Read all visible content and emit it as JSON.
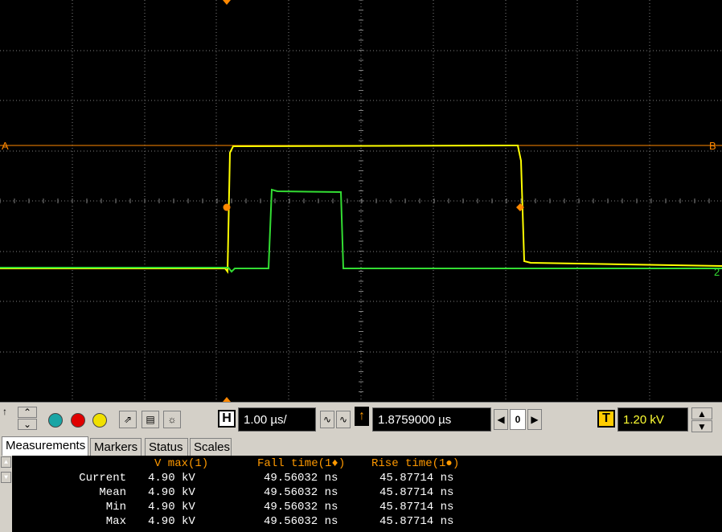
{
  "scope": {
    "marker_left": "A",
    "marker_right": "B",
    "channel_label": "2",
    "grid_color": "#808080",
    "ch1_color": "#ffff00",
    "ch2_color": "#33dd33",
    "marker_color": "#ff8800"
  },
  "toolbar": {
    "horizontal_label": "H",
    "timebase": "1.00 µs/",
    "delay_icon": "↑",
    "delay": "1.8759000 µs",
    "delay_zero": "0",
    "trigger_label": "T",
    "trigger_level": "1.20 kV",
    "channel_circles": [
      "#19a5a5",
      "#e00000",
      "#f0e000"
    ],
    "tilde1": "∿",
    "tilde2": "∿"
  },
  "tabs": [
    {
      "label": "Measurements",
      "active": true
    },
    {
      "label": "Markers",
      "active": false
    },
    {
      "label": "Status",
      "active": false
    },
    {
      "label": "Scales",
      "active": false
    }
  ],
  "measurements": {
    "headers": [
      "V max(1)",
      "Fall time(1♦)",
      "Rise time(1●)"
    ],
    "rows": [
      {
        "label": "Current",
        "v": [
          "4.90 kV",
          "49.56032 ns",
          "45.87714 ns"
        ]
      },
      {
        "label": "Mean",
        "v": [
          "4.90 kV",
          "49.56032 ns",
          "45.87714 ns"
        ]
      },
      {
        "label": "Min",
        "v": [
          "4.90 kV",
          "49.56032 ns",
          "45.87714 ns"
        ]
      },
      {
        "label": "Max",
        "v": [
          "4.90 kV",
          "49.56032 ns",
          "45.87714 ns"
        ]
      }
    ]
  }
}
